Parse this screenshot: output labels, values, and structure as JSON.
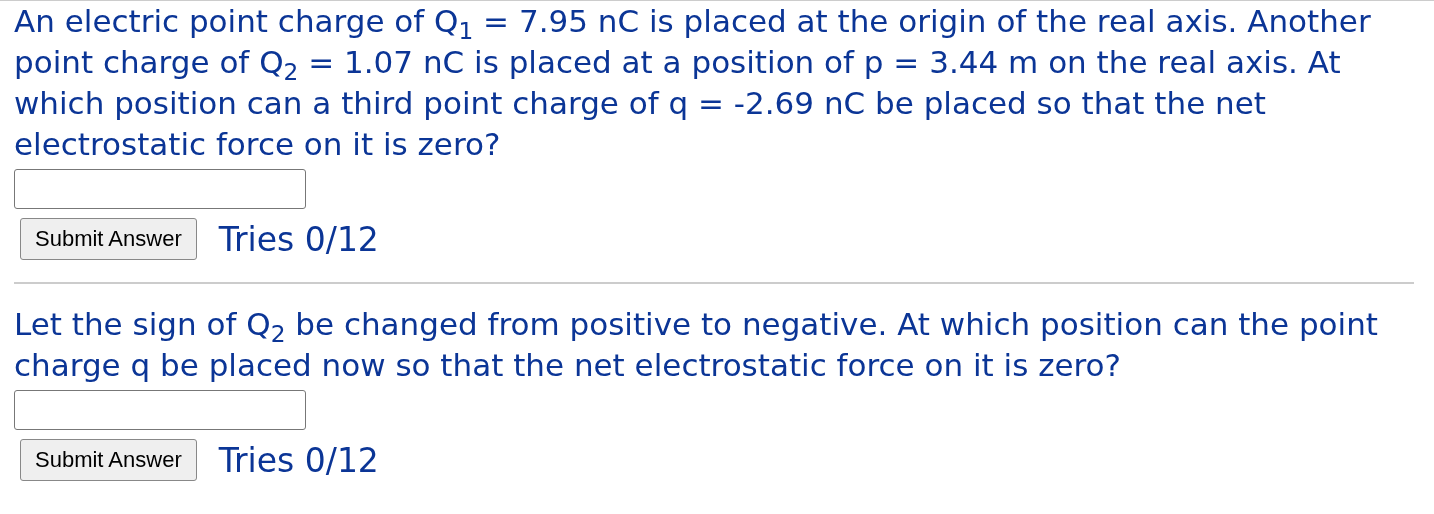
{
  "parts": [
    {
      "question": "An electric point charge of Q$_{1}$ = 7.95 nC is placed at the origin of the real axis. Another point charge of Q$_{2}$ = 1.07 nC is placed at a position of p = 3.44 m on the real axis. At which position can a third point charge of q = -2.69 nC be placed so that the net electrostatic force on it is zero?",
      "button": "Submit Answer",
      "tries": "Tries 0/12"
    },
    {
      "question": "Let the sign of Q$_{2}$ be changed from positive to negative. At which position can the point charge q be placed now so that the net electrostatic force on it is zero?",
      "button": "Submit Answer",
      "tries": "Tries 0/12"
    }
  ]
}
